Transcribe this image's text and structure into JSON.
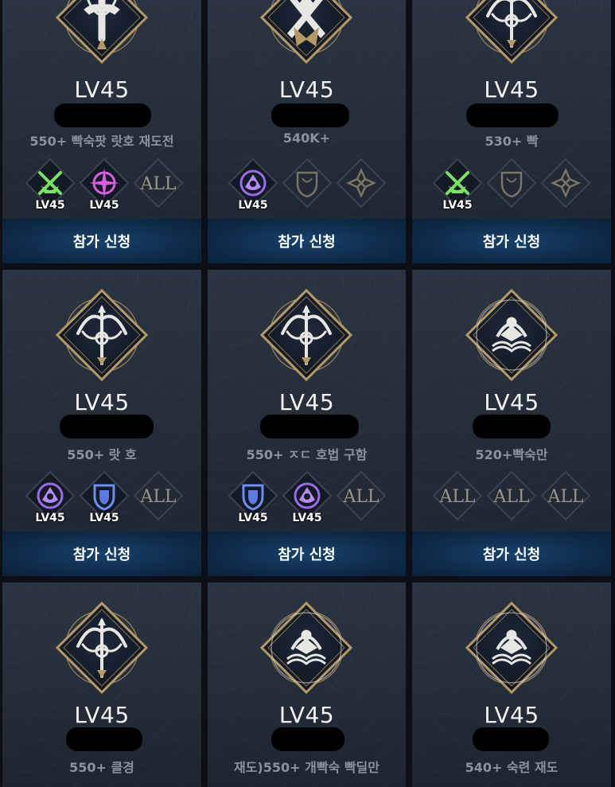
{
  "cards": [
    {
      "level": "LV45",
      "desc": "550+ 빡숙팟 랏호 재도전",
      "emblem": "greatsword-emblem-icon",
      "slots": [
        {
          "kind": "gunslinger",
          "lv": "LV45"
        },
        {
          "kind": "compass",
          "lv": "LV45"
        },
        {
          "kind": "all",
          "text": "ALL"
        }
      ],
      "join": "참가 신청"
    },
    {
      "level": "LV45",
      "desc": "540K+",
      "emblem": "crossed-swords-emblem-icon",
      "slots": [
        {
          "kind": "purple-crest",
          "lv": "LV45"
        },
        {
          "kind": "empty-shield"
        },
        {
          "kind": "empty-star"
        }
      ],
      "join": "참가 신청"
    },
    {
      "level": "LV45",
      "desc": "530+  빡",
      "emblem": "bow-emblem-icon",
      "slots": [
        {
          "kind": "gunslinger",
          "lv": "LV45"
        },
        {
          "kind": "empty-shield"
        },
        {
          "kind": "empty-star"
        }
      ],
      "join": "참가 신청"
    },
    {
      "level": "LV45",
      "desc": "550+ 랏 호",
      "emblem": "bow-emblem-icon",
      "slots": [
        {
          "kind": "purple-crest",
          "lv": "LV45"
        },
        {
          "kind": "blue-shield",
          "lv": "LV45"
        },
        {
          "kind": "all",
          "text": "ALL"
        }
      ],
      "join": "참가 신청"
    },
    {
      "level": "LV45",
      "desc": "550+ ㅈㄷ 호법 구함",
      "emblem": "bow-emblem-icon",
      "slots": [
        {
          "kind": "blue-shield",
          "lv": "LV45"
        },
        {
          "kind": "purple-crest",
          "lv": "LV45"
        },
        {
          "kind": "all",
          "text": "ALL"
        }
      ],
      "join": "참가 신청"
    },
    {
      "level": "LV45",
      "desc": "520+빡숙만",
      "emblem": "book-emblem-icon",
      "slots": [
        {
          "kind": "all",
          "text": "ALL"
        },
        {
          "kind": "all",
          "text": "ALL"
        },
        {
          "kind": "all",
          "text": "ALL"
        }
      ],
      "join": "참가 신청"
    },
    {
      "level": "LV45",
      "desc": "550+ 클경",
      "emblem": "bow-emblem-icon",
      "slots": [],
      "join": ""
    },
    {
      "level": "LV45",
      "desc": "재도)550+ 개빡숙 빡딜만",
      "emblem": "book-emblem-icon",
      "slots": [],
      "join": ""
    },
    {
      "level": "LV45",
      "desc": "540+ 숙련 재도",
      "emblem": "book-emblem-icon",
      "slots": [],
      "join": ""
    }
  ],
  "colors": {
    "card": "#262e3a",
    "join": "#123a5f",
    "desc": "#8d939c",
    "gold": "#b59a68"
  }
}
